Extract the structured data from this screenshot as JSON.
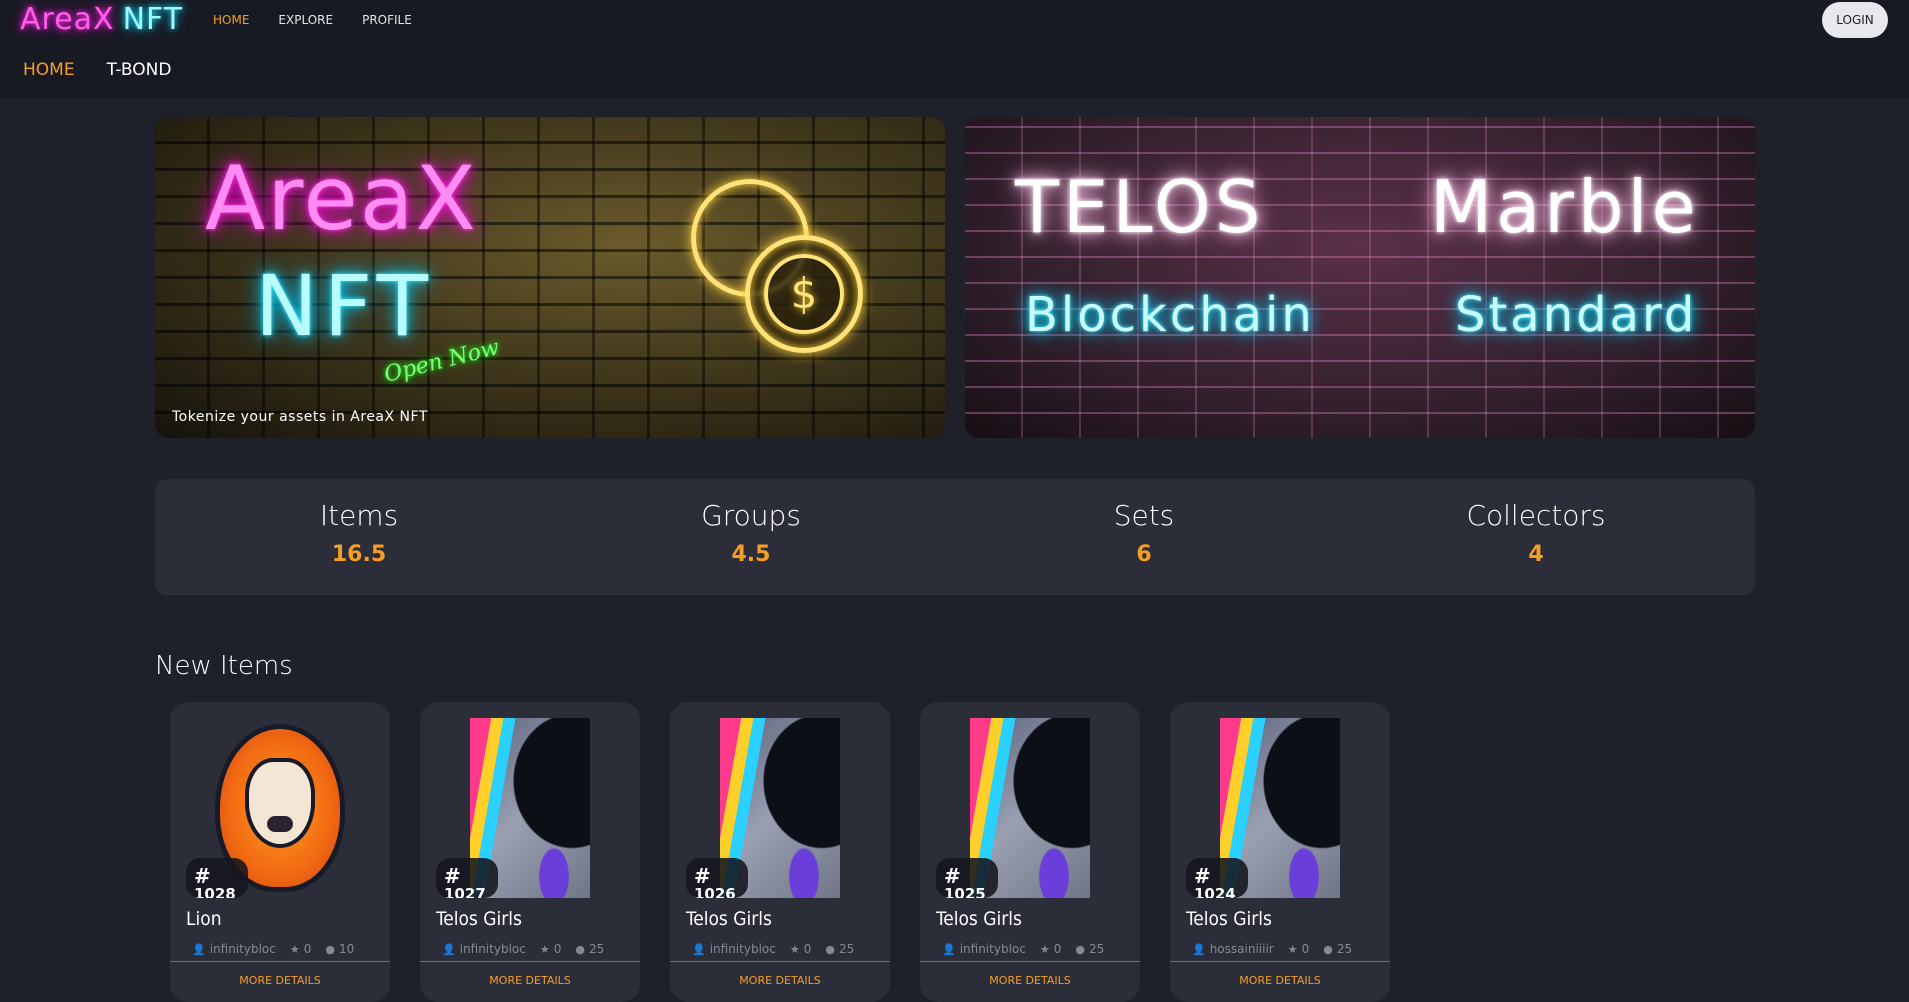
{
  "brand": {
    "logo_left": "AreaX",
    "logo_right": "NFT"
  },
  "topnav": [
    {
      "label": "HOME",
      "active": true
    },
    {
      "label": "EXPLORE",
      "active": false
    },
    {
      "label": "PROFILE",
      "active": false
    }
  ],
  "login_label": "LOGIN",
  "subnav": [
    {
      "label": "HOME",
      "active": true
    },
    {
      "label": "T-BOND",
      "active": false
    }
  ],
  "banners": {
    "first": {
      "line1": "AreaX",
      "line2": "NFT",
      "script": "Open Now",
      "coin_symbol": "$",
      "tagline": "Tokenize your assets in AreaX NFT"
    },
    "second": {
      "word1": "TELOS",
      "word2": "Marble",
      "word3": "Blockchain",
      "word4": "Standard"
    }
  },
  "stats": [
    {
      "label": "Items",
      "value": "16.5"
    },
    {
      "label": "Groups",
      "value": "4.5"
    },
    {
      "label": "Sets",
      "value": "6"
    },
    {
      "label": "Collectors",
      "value": "4"
    }
  ],
  "new_items": {
    "title": "New Items",
    "cards": [
      {
        "hash": "#",
        "number": "1028",
        "title": "Lion",
        "owner": "infinitybloc",
        "likes": "0",
        "count": "10",
        "more": "MORE DETAILS",
        "image": "lion"
      },
      {
        "hash": "#",
        "number": "1027",
        "title": "Telos Girls",
        "owner": "infinitybloc",
        "likes": "0",
        "count": "25",
        "more": "MORE DETAILS",
        "image": "girl"
      },
      {
        "hash": "#",
        "number": "1026",
        "title": "Telos Girls",
        "owner": "infinitybloc",
        "likes": "0",
        "count": "25",
        "more": "MORE DETAILS",
        "image": "girl"
      },
      {
        "hash": "#",
        "number": "1025",
        "title": "Telos Girls",
        "owner": "infinitybloc",
        "likes": "0",
        "count": "25",
        "more": "MORE DETAILS",
        "image": "girl"
      },
      {
        "hash": "#",
        "number": "1024",
        "title": "Telos Girls",
        "owner": "hossainiiiir",
        "likes": "0",
        "count": "25",
        "more": "MORE DETAILS",
        "image": "girl"
      }
    ]
  },
  "icons": {
    "user": "user-icon",
    "star": "star-icon",
    "circle": "circle-icon"
  },
  "colors": {
    "accent": "#f59e23",
    "background": "#1e202a",
    "panel": "#2b2d38"
  }
}
